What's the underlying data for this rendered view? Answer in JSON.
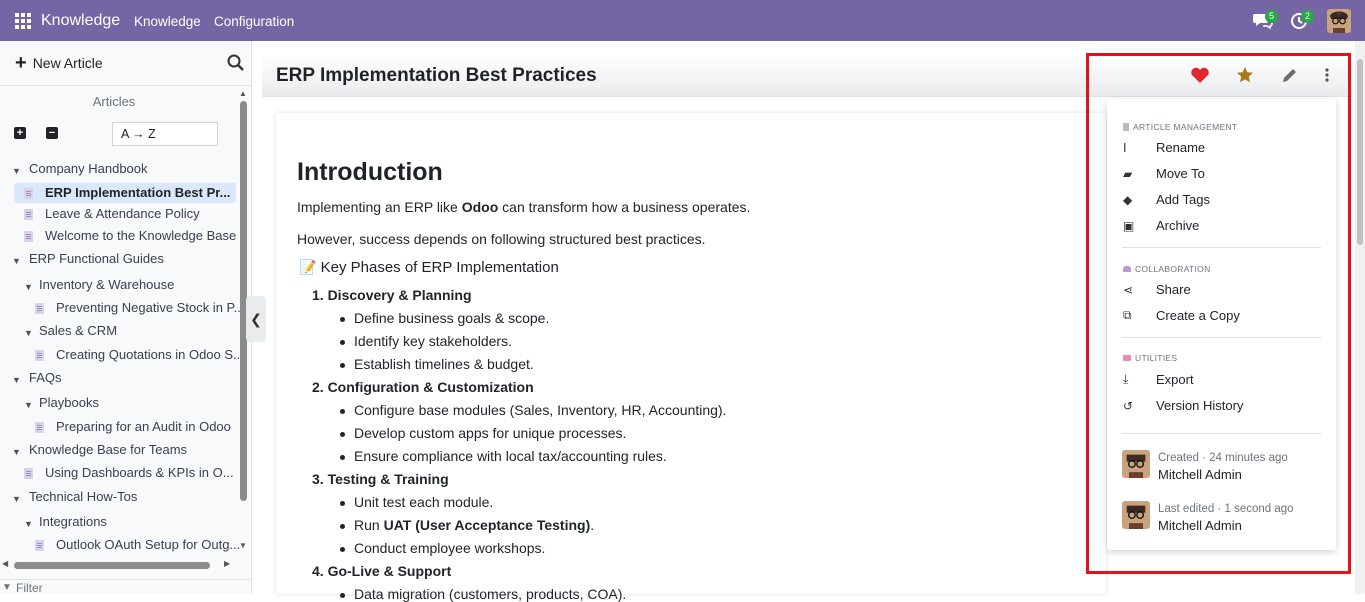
{
  "topbar": {
    "brand": "Knowledge",
    "menu": [
      "Knowledge",
      "Configuration"
    ],
    "messages_count": "5",
    "activities_count": "2"
  },
  "sidebar": {
    "new_article": "New Article",
    "articles_label": "Articles",
    "sort": "A → Z",
    "filter_placeholder": "Filter",
    "tree": [
      {
        "label": "Company Handbook"
      },
      {
        "label": "ERP Implementation Best Pr..."
      },
      {
        "label": "Leave & Attendance Policy"
      },
      {
        "label": "Welcome to the Knowledge Base"
      },
      {
        "label": "ERP Functional Guides"
      },
      {
        "label": "Inventory & Warehouse"
      },
      {
        "label": "Preventing Negative Stock in P..."
      },
      {
        "label": "Sales & CRM"
      },
      {
        "label": "Creating Quotations in Odoo S..."
      },
      {
        "label": "FAQs"
      },
      {
        "label": "Playbooks"
      },
      {
        "label": "Preparing for an Audit in Odoo"
      },
      {
        "label": "Knowledge Base for Teams"
      },
      {
        "label": "Using Dashboards & KPIs in O..."
      },
      {
        "label": "Technical How-Tos"
      },
      {
        "label": "Integrations"
      },
      {
        "label": "Outlook OAuth Setup for Outg..."
      }
    ]
  },
  "article": {
    "title": "ERP Implementation Best Practices",
    "heading": "Introduction",
    "p1_pre": "Implementing an ERP like ",
    "p1_bold": "Odoo",
    "p1_post": " can transform how a business operates.",
    "p2": "However, success depends on following structured best practices.",
    "phases_heading": "Key Phases of ERP Implementation",
    "phases": [
      {
        "title": "1. Discovery & Planning",
        "items": [
          "Define business goals & scope.",
          "Identify key stakeholders.",
          "Establish timelines & budget."
        ]
      },
      {
        "title": "2. Configuration & Customization",
        "items": [
          "Configure base modules (Sales, Inventory, HR, Accounting).",
          "Develop custom apps for unique processes.",
          "Ensure compliance with local tax/accounting rules."
        ]
      },
      {
        "title": "3. Testing & Training",
        "items": [
          "Unit test each module.",
          "Run ",
          "Conduct employee workshops."
        ]
      },
      {
        "title": "4. Go-Live & Support",
        "items": [
          "Data migration (customers, products, COA)."
        ]
      }
    ],
    "uat_bold": "UAT (User Acceptance Testing)",
    "uat_post": "."
  },
  "menu": {
    "article_management": "ARTICLE MANAGEMENT",
    "rename": "Rename",
    "move_to": "Move To",
    "add_tags": "Add Tags",
    "archive": "Archive",
    "collaboration": "COLLABORATION",
    "share": "Share",
    "create_copy": "Create a Copy",
    "utilities": "UTILITIES",
    "export": "Export",
    "version_history": "Version History",
    "created_meta": "Created · 24 minutes ago",
    "created_by": "Mitchell Admin",
    "edited_meta": "Last edited · 1 second ago",
    "edited_by": "Mitchell Admin"
  },
  "colors": {
    "topbar": "#7565a4",
    "favorite": "#e0262f",
    "star": "#a8781d",
    "highlight": "#e0131b"
  }
}
